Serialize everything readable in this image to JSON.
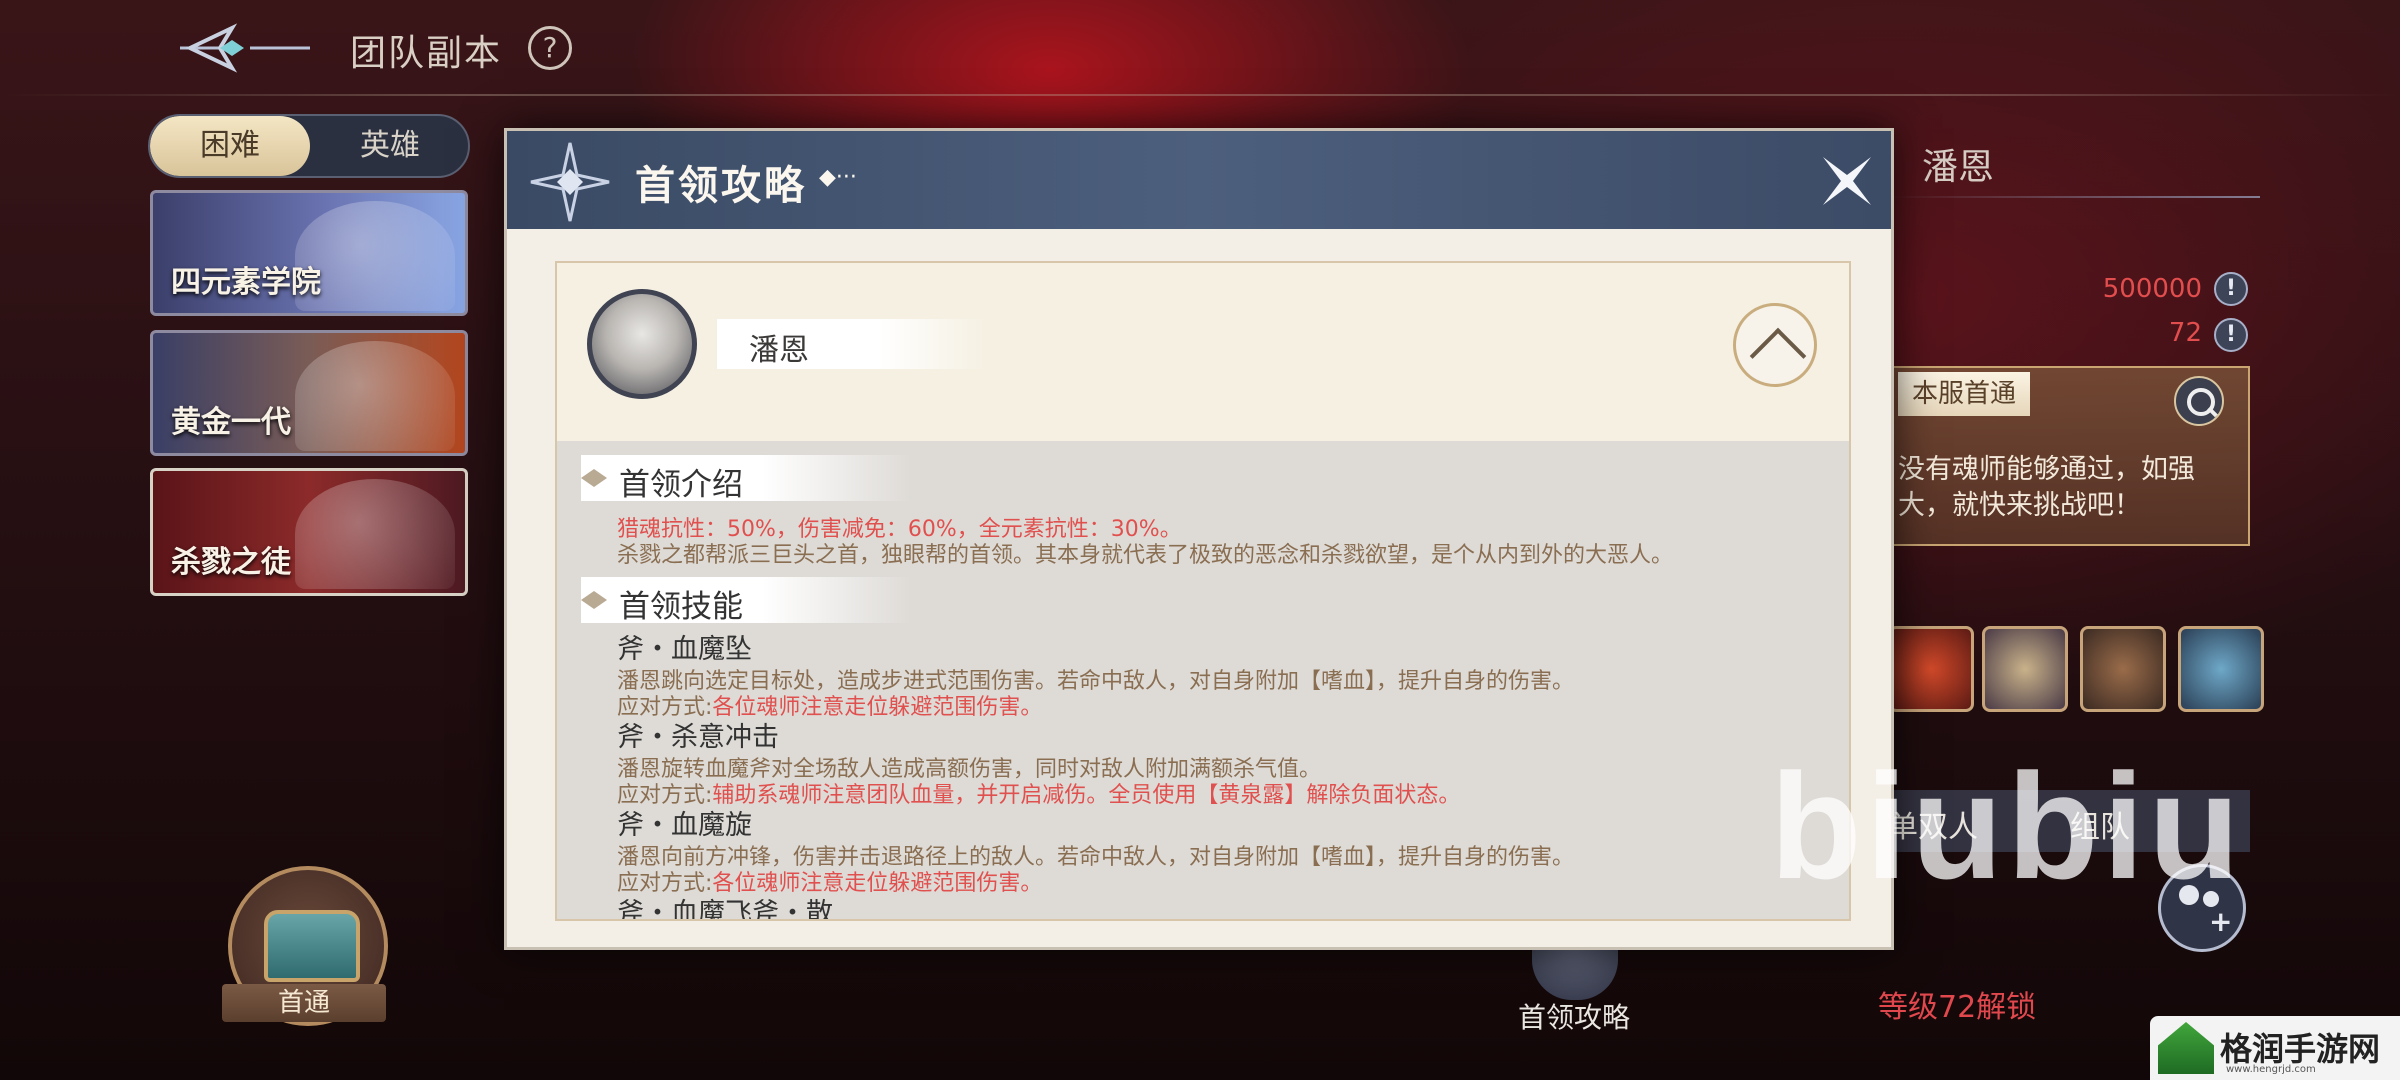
{
  "topbar": {
    "title": "团队副本",
    "help": "?"
  },
  "difficulty": {
    "active": "困难",
    "inactive": "英雄"
  },
  "dungeons": [
    {
      "label": "四元素学院"
    },
    {
      "label": "黄金一代"
    },
    {
      "label": "杀戮之徒"
    }
  ],
  "chest": {
    "label": "首通"
  },
  "right": {
    "boss_name": "潘恩",
    "stat1": "500000",
    "stat2": "72",
    "first_clear_tag": "本服首通",
    "first_clear_text": "没有魂师能够通过，如强大，就快来挑战吧！",
    "team_solo": "单双人",
    "team_group": "组队",
    "unlock": "等级72解锁",
    "boss_guide_label": "首领攻略"
  },
  "watermark": "biubiu",
  "site": {
    "name": "格润手游网",
    "url": "www.hengrjd.com"
  },
  "modal": {
    "title": "首领攻略",
    "title_deco": "◆···",
    "boss_name": "潘恩",
    "intro_heading": "首领介绍",
    "intro_resist": "猎魂抗性：50%，伤害减免：60%，全元素抗性：30%。",
    "intro_desc": "杀戮之都帮派三巨头之首，独眼帮的首领。其本身就代表了极致的恶念和杀戮欲望，是个从内到外的大恶人。",
    "skills_heading": "首领技能",
    "skills": [
      {
        "name": "斧・血魔坠",
        "desc": "潘恩跳向选定目标处，造成步进式范围伤害。若命中敌人，对自身附加【嗜血】，提升自身的伤害。",
        "counter_prefix": "应对方式:",
        "counter": "各位魂师注意走位躲避范围伤害。"
      },
      {
        "name": "斧・杀意冲击",
        "desc": "潘恩旋转血魔斧对全场敌人造成高额伤害，同时对敌人附加满额杀气值。",
        "counter_prefix": "应对方式:",
        "counter": "辅助系魂师注意团队血量，并开启减伤。全员使用【黄泉露】解除负面状态。"
      },
      {
        "name": "斧・血魔旋",
        "desc": "潘恩向前方冲锋，伤害并击退路径上的敌人。若命中敌人，对自身附加【嗜血】，提升自身的伤害。",
        "counter_prefix": "应对方式:",
        "counter": "各位魂师注意走位躲避范围伤害。"
      },
      {
        "name": "斧・血魔飞斧・散"
      }
    ]
  }
}
